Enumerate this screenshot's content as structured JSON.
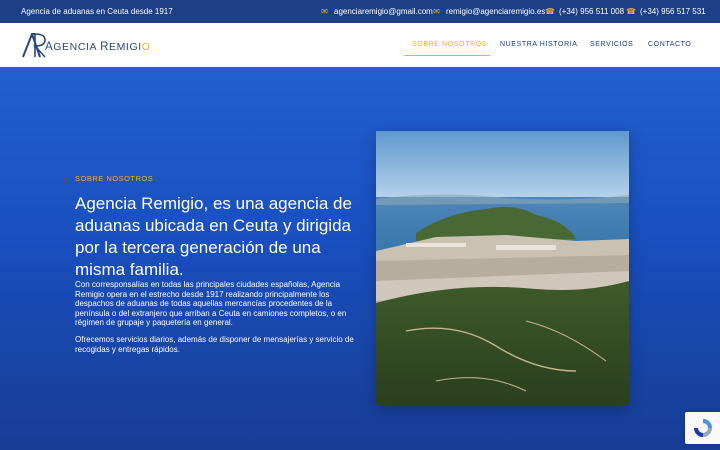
{
  "topbar": {
    "tagline": "Agencia de aduanas en Ceuta desde 1917",
    "email1": "agenciaremigio@gmail.com",
    "email2": "remigio@agenciaremigio.es",
    "phone1": "(+34) 956 511 008",
    "phone2": "(+34) 956 517 531",
    "icons": {
      "email": "envelope-icon",
      "phone": "phone-icon"
    }
  },
  "header": {
    "logo": {
      "first": "A",
      "middle": "GENCIA ",
      "cap2": "R",
      "rest": "EMIGI",
      "last": "O"
    },
    "nav": [
      {
        "label": "SOBRE NOSOTROS",
        "active": true
      },
      {
        "label": "NUESTRA HISTORIA",
        "active": false
      },
      {
        "label": "SERVICIOS",
        "active": false
      },
      {
        "label": "CONTACTO",
        "active": false
      }
    ]
  },
  "hero": {
    "eyebrow": "SOBRE NOSOTROS",
    "headline": "Agencia Remigio, es una agencia de aduanas ubicada en Ceuta y dirigida por la tercera generación de una misma familia.",
    "paragraph1": "Con corresponsalías en todas las principales ciudades españolas, Agencia Remigio opera en el estrecho desde 1917 realizando principalmente los despachos de aduanas de todas aquellas mercancías procedentes de la península o del extranjero que arriban a Ceuta en camiones completos, o en régimen de grupaje y paquetería en general.",
    "paragraph2": "Ofrecemos servicios diarios, además de disponer de mensajerías y servicio de recogidas y entregas rápidos."
  },
  "colors": {
    "brand_blue": "#1d3f86",
    "accent_gold": "#f2b11d",
    "hero_blue": "#1a4fb8"
  }
}
